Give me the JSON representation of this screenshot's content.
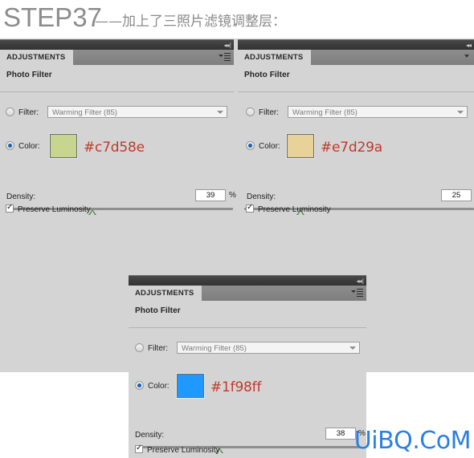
{
  "heading": {
    "step": "STEP37",
    "subtitle": "——加上了三照片滤镜调整层："
  },
  "panels": [
    {
      "tab_label": "ADJUSTMENTS",
      "header": "Photo Filter",
      "filter_label": "Filter:",
      "filter_value": "Warming Filter (85)",
      "filter_selected": false,
      "color_label": "Color:",
      "color_selected": true,
      "color_swatch": "#c7d58e",
      "color_hex_text": "#c7d58e",
      "density_label": "Density:",
      "density_value": "39",
      "density_unit": "%",
      "preserve_label": "Preserve Luminosity",
      "preserve_checked": true
    },
    {
      "tab_label": "ADJUSTMENTS",
      "header": "Photo Filter",
      "filter_label": "Filter:",
      "filter_value": "Warming Filter (85)",
      "filter_selected": false,
      "color_label": "Color:",
      "color_selected": true,
      "color_swatch": "#e7d29a",
      "color_hex_text": "#e7d29a",
      "density_label": "Density:",
      "density_value": "25",
      "density_unit": "%",
      "preserve_label": "Preserve Luminosity",
      "preserve_checked": true
    },
    {
      "tab_label": "ADJUSTMENTS",
      "header": "Photo Filter",
      "filter_label": "Filter:",
      "filter_value": "Warming Filter (85)",
      "filter_selected": false,
      "color_label": "Color:",
      "color_selected": true,
      "color_swatch": "#1f98ff",
      "color_hex_text": "#1f98ff",
      "density_label": "Density:",
      "density_value": "38",
      "density_unit": "%",
      "preserve_label": "Preserve Luminosity",
      "preserve_checked": true
    }
  ],
  "icons": {
    "collapse": "◀◀ |",
    "panel_menu": "panel-menu-icon"
  },
  "watermark": "UiBQ.CoM",
  "colors": {
    "panel_bg": "#d4d4d4",
    "titlebar": "#3c3c3c",
    "tabstrip": "#828282",
    "hex_text": "#c0392b",
    "watermark": "#2a7fe0",
    "heading_text": "#8c8c8c"
  }
}
